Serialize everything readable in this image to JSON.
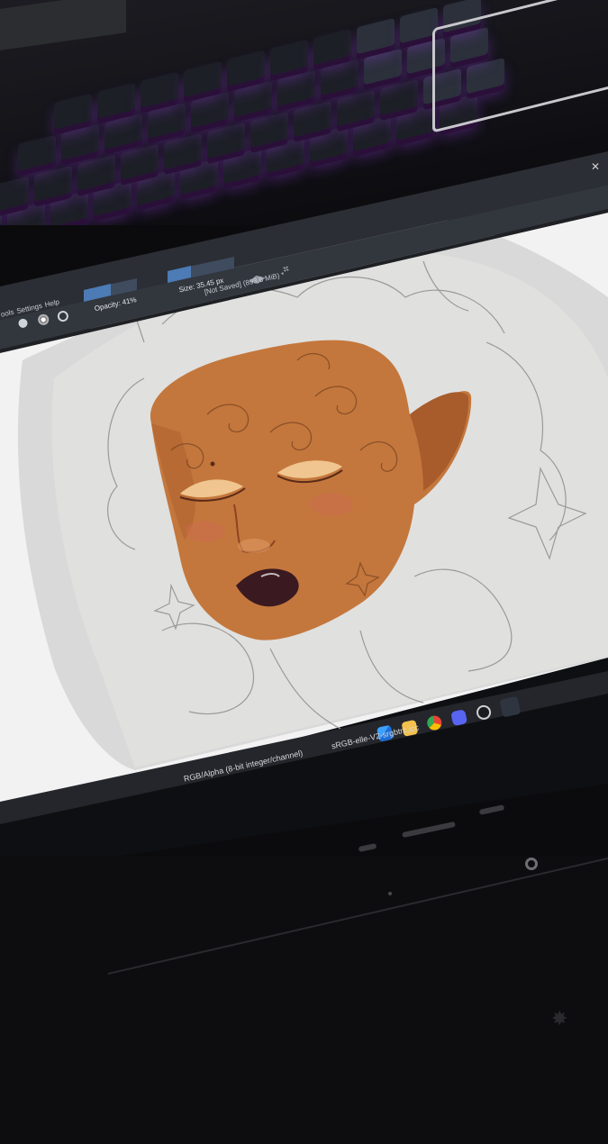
{
  "toolbar": {
    "menu_tools": "ools",
    "menu_settings": "Settings",
    "menu_help": "Help",
    "opacity_label": "Opacity: 41%",
    "size_label": "Size: 35.45 px",
    "doc_status": "[Not Saved]  (893.6 MiB) *"
  },
  "status_bar": {
    "color_mode": "RGB/Alpha (8-bit integer/channel)",
    "color_profile": "sRGB-elle-V2-srgbtrc.icc"
  },
  "taskbar": {
    "icons": [
      "windows-start-icon",
      "file-explorer-icon",
      "chrome-icon",
      "discord-icon",
      "obs-icon",
      "krita-icon"
    ]
  },
  "colors": {
    "canvas_bg": "#f1f1f1",
    "paper": "#d6d6d6",
    "skin": "#c8773a",
    "skin_shadow": "#9a5028",
    "toolbar_bg": "#2e3138",
    "keyboard_glow": "#a24fe0"
  }
}
